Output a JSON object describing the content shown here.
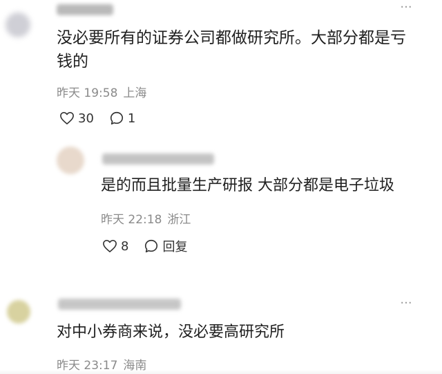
{
  "comments": [
    {
      "text": "没必要所有的证券公司都做研究所。大部分都是亏钱的",
      "time": "昨天 19:58",
      "location": "上海",
      "likes": "30",
      "replies": "1"
    },
    {
      "text": "是的而且批量生产研报 大部分都是电子垃圾",
      "time": "昨天 22:18",
      "location": "浙江",
      "likes": "8",
      "reply_label": "回复"
    },
    {
      "text": "对中小券商来说，没必要高研究所",
      "time": "昨天 23:17",
      "location": "海南"
    }
  ],
  "colors": {
    "text": "#1f1f1f",
    "meta": "#8a8a8a",
    "icon": "#333333"
  }
}
